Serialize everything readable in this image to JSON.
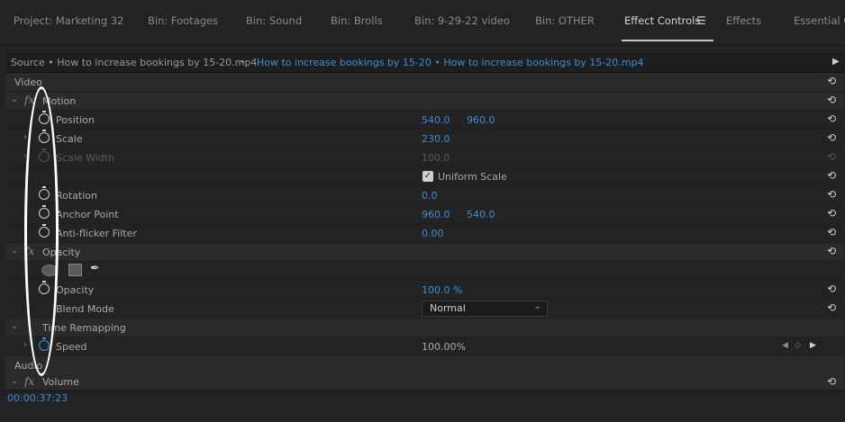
{
  "tabs": [
    {
      "label": "Project: Marketing 32"
    },
    {
      "label": "Bin: Footages"
    },
    {
      "label": "Bin: Sound"
    },
    {
      "label": "Bin: Brolls"
    },
    {
      "label": "Bin: 9-29-22 video"
    },
    {
      "label": "Bin: OTHER"
    },
    {
      "label": "Effect Controls"
    },
    {
      "label": "Effects"
    },
    {
      "label": "Essential Gi"
    }
  ],
  "source": {
    "left": "Source • How to increase bookings by 15-20.mp4",
    "right": "How to increase bookings by 15-20 • How to increase bookings by 15-20.mp4"
  },
  "rows": {
    "video": "Video",
    "motion": "Motion",
    "position": {
      "label": "Position",
      "x": "540.0",
      "y": "960.0"
    },
    "scale": {
      "label": "Scale",
      "value": "230.0"
    },
    "scale_width": {
      "label": "Scale Width",
      "value": "100.0"
    },
    "uniform_scale": "Uniform Scale",
    "rotation": {
      "label": "Rotation",
      "value": "0.0"
    },
    "anchor": {
      "label": "Anchor Point",
      "x": "960.0",
      "y": "540.0"
    },
    "antiflicker": {
      "label": "Anti-flicker Filter",
      "value": "0.00"
    },
    "opacity_section": "Opacity",
    "opacity": {
      "label": "Opacity",
      "value": "100.0 %"
    },
    "blend": {
      "label": "Blend Mode",
      "value": "Normal"
    },
    "time_remap": "Time Remapping",
    "speed": {
      "label": "Speed",
      "value": "100.00%"
    },
    "audio": "Audio",
    "volume": "Volume"
  },
  "timecode": "00:00:37:23",
  "icons": {
    "reset": "reset-icon",
    "stopwatch": "stopwatch-icon",
    "menu": "hamburger-menu-icon"
  },
  "colors": {
    "accent": "#3f8ed6",
    "bg": "#232323"
  }
}
